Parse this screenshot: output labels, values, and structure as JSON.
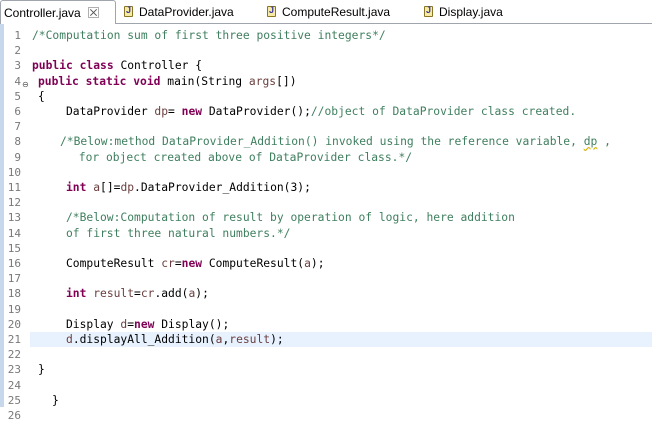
{
  "tabs": [
    {
      "label": "Controller.java",
      "active": true,
      "icon": "java-file-icon",
      "closable": true
    },
    {
      "label": "DataProvider.java",
      "active": false,
      "icon": "java-file-icon"
    },
    {
      "label": "ComputeResult.java",
      "active": false,
      "icon": "java-file-icon"
    },
    {
      "label": "Display.java",
      "active": false,
      "icon": "java-file-icon"
    }
  ],
  "editor": {
    "current_line": 21,
    "lines": [
      {
        "n": "1",
        "tokens": [
          {
            "t": "/*Computation sum of first three positive integers*/",
            "c": "cm"
          }
        ]
      },
      {
        "n": "2",
        "tokens": []
      },
      {
        "n": "3",
        "tokens": [
          {
            "t": "public",
            "c": "kw"
          },
          {
            "t": " "
          },
          {
            "t": "class",
            "c": "kw"
          },
          {
            "t": " Controller {"
          }
        ]
      },
      {
        "n": "4",
        "fold": true,
        "tokens": [
          {
            "t": "public",
            "c": "kw"
          },
          {
            "t": " "
          },
          {
            "t": "static",
            "c": "kw"
          },
          {
            "t": " "
          },
          {
            "t": "void",
            "c": "kw"
          },
          {
            "t": " main(String "
          },
          {
            "t": "args",
            "c": "var"
          },
          {
            "t": "[])"
          }
        ]
      },
      {
        "n": "5",
        "tokens": [
          {
            "t": "{"
          }
        ]
      },
      {
        "n": "6",
        "tokens": [
          {
            "t": "DataProvider "
          },
          {
            "t": "dp",
            "c": "var"
          },
          {
            "t": "= "
          },
          {
            "t": "new",
            "c": "kw"
          },
          {
            "t": " DataProvider();"
          },
          {
            "t": "//object of DataProvider class created.",
            "c": "cm"
          }
        ]
      },
      {
        "n": "7",
        "tokens": []
      },
      {
        "n": "8",
        "tokens": [
          {
            "t": "/*Below:method DataProvider_Addition() invoked using the reference variable, ",
            "c": "cm"
          },
          {
            "t": "dp",
            "c": "cm",
            "squiggle": true
          },
          {
            "t": " ,",
            "c": "cm"
          }
        ]
      },
      {
        "n": "9",
        "tokens": [
          {
            "t": " for object created above of DataProvider class.*/",
            "c": "cm"
          }
        ]
      },
      {
        "n": "10",
        "tokens": []
      },
      {
        "n": "11",
        "tokens": [
          {
            "t": "int",
            "c": "kw"
          },
          {
            "t": " "
          },
          {
            "t": "a",
            "c": "var"
          },
          {
            "t": "[]="
          },
          {
            "t": "dp",
            "c": "var"
          },
          {
            "t": ".DataProvider_Addition(3);"
          }
        ]
      },
      {
        "n": "12",
        "tokens": []
      },
      {
        "n": "13",
        "tokens": [
          {
            "t": "/*Below:Computation of result by operation of logic, here addition",
            "c": "cm"
          }
        ]
      },
      {
        "n": "14",
        "tokens": [
          {
            "t": "of first three natural numbers.*/",
            "c": "cm"
          }
        ]
      },
      {
        "n": "15",
        "tokens": []
      },
      {
        "n": "16",
        "tokens": [
          {
            "t": "ComputeResult "
          },
          {
            "t": "cr",
            "c": "var"
          },
          {
            "t": "="
          },
          {
            "t": "new",
            "c": "kw"
          },
          {
            "t": " ComputeResult("
          },
          {
            "t": "a",
            "c": "var"
          },
          {
            "t": ");"
          }
        ]
      },
      {
        "n": "17",
        "tokens": []
      },
      {
        "n": "18",
        "tokens": [
          {
            "t": "int",
            "c": "kw"
          },
          {
            "t": " "
          },
          {
            "t": "result",
            "c": "var"
          },
          {
            "t": "="
          },
          {
            "t": "cr",
            "c": "var"
          },
          {
            "t": ".add("
          },
          {
            "t": "a",
            "c": "var"
          },
          {
            "t": ");"
          }
        ]
      },
      {
        "n": "19",
        "tokens": []
      },
      {
        "n": "20",
        "tokens": [
          {
            "t": "Display "
          },
          {
            "t": "d",
            "c": "var"
          },
          {
            "t": "="
          },
          {
            "t": "new",
            "c": "kw"
          },
          {
            "t": " Display();"
          }
        ]
      },
      {
        "n": "21",
        "tokens": [
          {
            "t": "d",
            "c": "var"
          },
          {
            "t": ".displayAll_Addition("
          },
          {
            "t": "a",
            "c": "var"
          },
          {
            "t": ","
          },
          {
            "t": "result",
            "c": "var"
          },
          {
            "t": ");"
          }
        ]
      },
      {
        "n": "22",
        "tokens": []
      },
      {
        "n": "23",
        "tokens": [
          {
            "t": "}"
          }
        ]
      },
      {
        "n": "24",
        "tokens": []
      },
      {
        "n": "25",
        "tokens": [
          {
            "t": "}"
          }
        ]
      },
      {
        "n": "26",
        "tokens": []
      }
    ]
  },
  "colors": {
    "keyword": "#7f0055",
    "comment": "#3f7f5f",
    "variable": "#6a3e3e",
    "current_line": "#e8f2fe",
    "gutter": "#c7d7ec"
  }
}
